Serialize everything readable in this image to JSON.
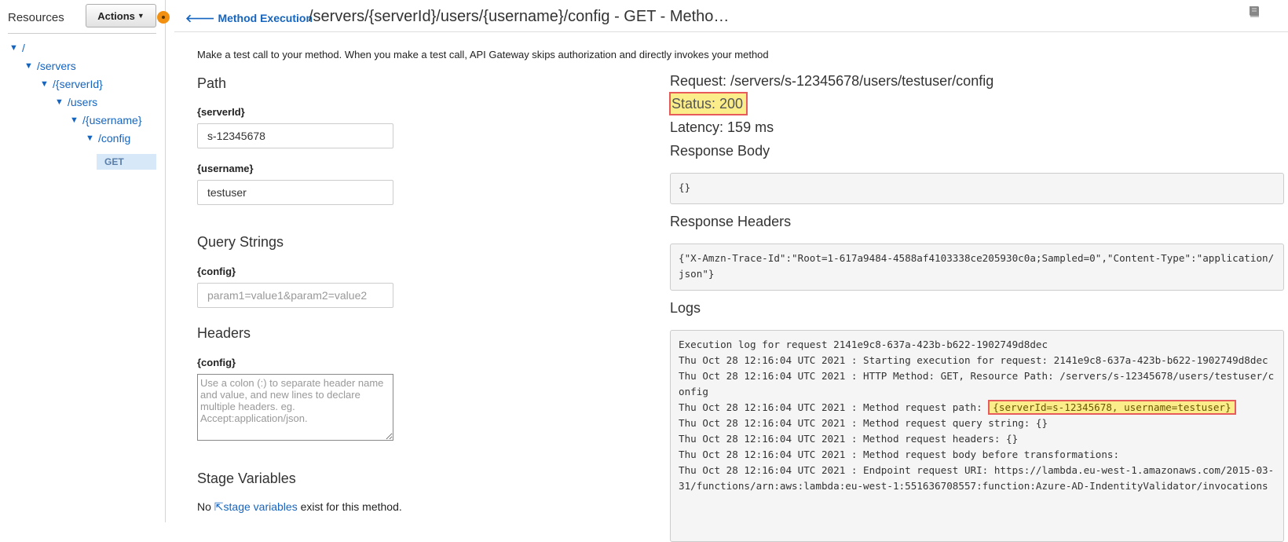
{
  "sidebar": {
    "title": "Resources",
    "actions_label": "Actions",
    "tree": [
      {
        "label": "/"
      },
      {
        "label": "/servers"
      },
      {
        "label": "/{serverId}"
      },
      {
        "label": "/users"
      },
      {
        "label": "/{username}"
      },
      {
        "label": "/config"
      }
    ],
    "method_label": "GET"
  },
  "header": {
    "back_label": "Method Execution",
    "title": "/servers/{serverId}/users/{username}/config - GET - Metho…"
  },
  "intro": "Make a test call to your method. When you make a test call, API Gateway skips authorization and directly invokes your method",
  "path": {
    "heading": "Path",
    "server_id_label": "{serverId}",
    "server_id_value": "s-12345678",
    "username_label": "{username}",
    "username_value": "testuser"
  },
  "query": {
    "heading": "Query Strings",
    "label": "{config}",
    "placeholder": "param1=value1&param2=value2"
  },
  "headers": {
    "heading": "Headers",
    "label": "{config}",
    "placeholder": "Use a colon (:) to separate header name and value, and new lines to declare multiple headers. eg. Accept:application/json."
  },
  "stage": {
    "heading": "Stage Variables",
    "pre": "No ",
    "link": "stage variables",
    "post": " exist for this method."
  },
  "result": {
    "request": "Request: /servers/s-12345678/users/testuser/config",
    "status": "Status: 200",
    "latency": "Latency: 159 ms",
    "body_heading": "Response Body",
    "body": "{}",
    "resp_headers_heading": "Response Headers",
    "resp_headers": "{\"X-Amzn-Trace-Id\":\"Root=1-617a9484-4588af4103338ce205930c0a;Sampled=0\",\"Content-Type\":\"application/json\"}",
    "logs_heading": "Logs",
    "logs": {
      "line1": "Execution log for request 2141e9c8-637a-423b-b622-1902749d8dec",
      "line2": "Thu Oct 28 12:16:04 UTC 2021 : Starting execution for request: 2141e9c8-637a-423b-b622-1902749d8dec",
      "line3": "Thu Oct 28 12:16:04 UTC 2021 : HTTP Method: GET, Resource Path: /servers/s-12345678/users/testuser/config",
      "line4_pre": "Thu Oct 28 12:16:04 UTC 2021 : Method request path: ",
      "line4_hl": "{serverId=s-12345678, username=testuser}",
      "line5": "Thu Oct 28 12:16:04 UTC 2021 : Method request query string: {}",
      "line6": "Thu Oct 28 12:16:04 UTC 2021 : Method request headers: {}",
      "line7": "Thu Oct 28 12:16:04 UTC 2021 : Method request body before transformations:",
      "line8": "Thu Oct 28 12:16:04 UTC 2021 : Endpoint request URI: https://lambda.eu-west-1.amazonaws.com/2015-03-31/functions/arn:aws:lambda:eu-west-1:551636708557:function:Azure-AD-IndentityValidator/invocations"
    }
  },
  "colors": {
    "link": "#1565c0",
    "highlight": "#fbed8a",
    "highlight_border": "#e85b5b",
    "orange_indicator": "#f29111"
  }
}
